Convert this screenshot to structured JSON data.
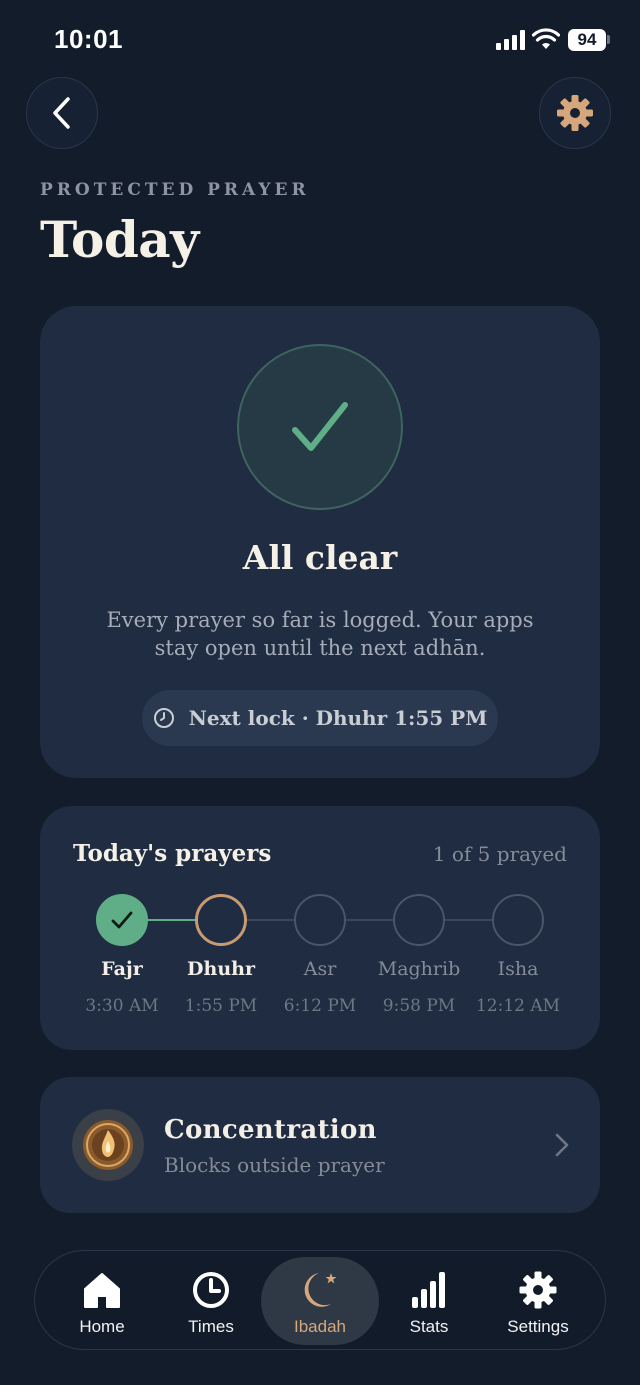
{
  "status_bar": {
    "time": "10:01",
    "battery": "94"
  },
  "header": {
    "eyebrow": "PROTECTED PRAYER",
    "title": "Today"
  },
  "status_card": {
    "heading": "All clear",
    "body": "Every prayer so far is logged. Your apps stay open until the next adhān.",
    "next_lock": "Next lock · Dhuhr 1:55 PM"
  },
  "prayers": {
    "title": "Today's prayers",
    "count": "1 of 5 prayed",
    "items": [
      {
        "name": "Fajr",
        "time": "3:30 AM",
        "state": "done"
      },
      {
        "name": "Dhuhr",
        "time": "1:55 PM",
        "state": "current"
      },
      {
        "name": "Asr",
        "time": "6:12 PM",
        "state": "upcoming"
      },
      {
        "name": "Maghrib",
        "time": "9:58 PM",
        "state": "upcoming"
      },
      {
        "name": "Isha",
        "time": "12:12 AM",
        "state": "upcoming"
      }
    ]
  },
  "concentration": {
    "title": "Concentration",
    "subtitle": "Blocks outside prayer"
  },
  "nav": {
    "items": [
      {
        "label": "Home",
        "icon": "home-icon"
      },
      {
        "label": "Times",
        "icon": "clock-icon"
      },
      {
        "label": "Ibadah",
        "icon": "crescent-star-icon",
        "active": true
      },
      {
        "label": "Stats",
        "icon": "bar-chart-icon"
      },
      {
        "label": "Settings",
        "icon": "gear-icon"
      }
    ]
  },
  "colors": {
    "accent": "#d6a77c",
    "success": "#5fae87",
    "background": "#131c2b",
    "card": "#1f2c41"
  }
}
